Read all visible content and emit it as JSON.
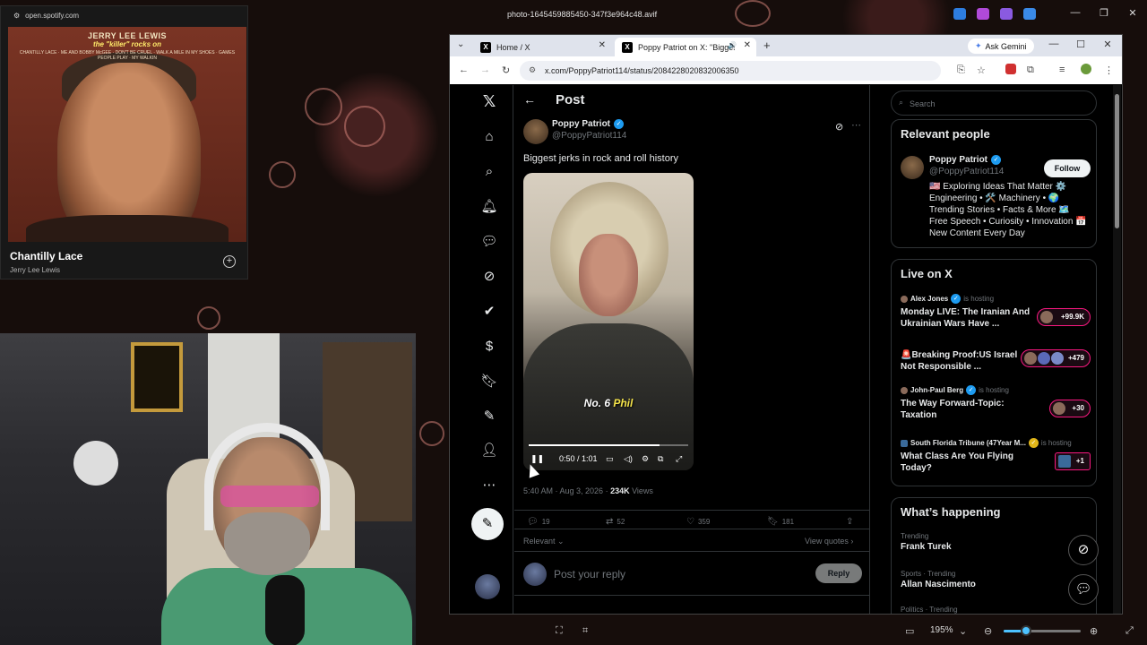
{
  "viewer": {
    "filename": "photo-1645459885450-347f3e964c48.avif",
    "zoom": "195%",
    "zoom_level": 0.25
  },
  "spotify": {
    "url": "open.spotify.com",
    "album_title": "JERRY LEE LEWIS",
    "album_subtitle": "the \"killer\" rocks on",
    "album_songs": "CHANTILLY LACE · ME AND BOBBY McGEE · DON'T BE CRUEL · WALK A MILE IN MY SHOES · GAMES PEOPLE PLAY · MY WALKIN",
    "song": "Chantilly Lace",
    "artist": "Jerry Lee Lewis"
  },
  "browser": {
    "tabs": [
      {
        "label": "Home / X",
        "active": false
      },
      {
        "label": "Poppy Patriot on X: \"Bigges",
        "active": true
      }
    ],
    "gemini_label": "Ask Gemini",
    "url": "x.com/PoppyPatriot114/status/2084228020832006350"
  },
  "post": {
    "header": "Post",
    "author_name": "Poppy Patriot",
    "author_handle": "@PoppyPatriot114",
    "text": "Biggest jerks in rock and roll history",
    "video_caption_prefix": "No. 6 ",
    "video_caption_highlight": "Phil",
    "video_time": "0:50 / 1:01",
    "video_progress": 0.82,
    "meta_time": "5:40 AM · Aug 3, 2026 · ",
    "meta_views": "234K",
    "meta_views_label": " Views",
    "replies": "19",
    "reposts": "52",
    "likes": "359",
    "bookmarks": "181",
    "relevant_label": "Relevant",
    "view_quotes_label": "View quotes",
    "reply_placeholder": "Post your reply",
    "reply_button": "Reply"
  },
  "sidebar": {
    "search_placeholder": "Search",
    "relevant_title": "Relevant people",
    "person_name": "Poppy Patriot",
    "person_handle": "@PoppyPatriot114",
    "follow_label": "Follow",
    "person_bio": "🇺🇸 Exploring Ideas That Matter ⚙️ Engineering • 🛠️ Machinery • 🌍 Trending Stories • Facts & More 🗺️ Free Speech • Curiosity • Innovation 📅 New Content Every Day",
    "live_title": "Live on X",
    "live_items": [
      {
        "host": "Alex Jones",
        "hosting": "is hosting",
        "title": "Monday LIVE: The Iranian And Ukrainian Wars Have ...",
        "count": "+99.9K"
      },
      {
        "host": "",
        "hosting": "",
        "title": "🚨Breaking Proof:US Israel Not Responsible ...",
        "count": "+479"
      },
      {
        "host": "John-Paul Berg",
        "hosting": "is hosting",
        "title": "The Way Forward-Topic: Taxation",
        "count": "+30"
      },
      {
        "host": "South Florida Tribune (47Year M...",
        "hosting": "is hosting",
        "title": "What Class Are You Flying Today?",
        "count": "+1"
      }
    ],
    "happening_title": "What’s happening",
    "trends": [
      {
        "category": "Trending",
        "name": "Frank Turek"
      },
      {
        "category": "Sports · Trending",
        "name": "Allan Nascimento"
      },
      {
        "category": "Politics · Trending",
        "name": ""
      }
    ]
  }
}
